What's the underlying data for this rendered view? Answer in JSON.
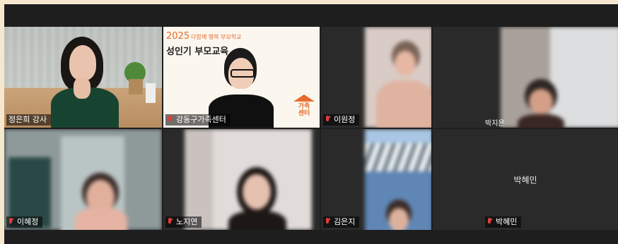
{
  "participants": [
    {
      "name": "정은희 강사",
      "muted": true,
      "active": true
    },
    {
      "name": "강동구가족센터",
      "muted": true,
      "active": false
    },
    {
      "name": "이원정",
      "muted": true,
      "active": false
    },
    {
      "name": "박지은",
      "muted": false,
      "active": false
    },
    {
      "name": "이혜정",
      "muted": true,
      "active": false
    },
    {
      "name": "노지연",
      "muted": true,
      "active": false
    },
    {
      "name": "김은지",
      "muted": true,
      "active": false
    },
    {
      "name": "박혜민",
      "muted": true,
      "active": false
    }
  ],
  "presentation": {
    "year": "2025",
    "subtitle": "다함께 행복 부모학교",
    "title": "성인기 부모교육",
    "logo_text": "가족센터"
  },
  "colors": {
    "active_border": "#37c86a",
    "muted_icon": "#e43a3a",
    "background": "#1e1e1e"
  }
}
